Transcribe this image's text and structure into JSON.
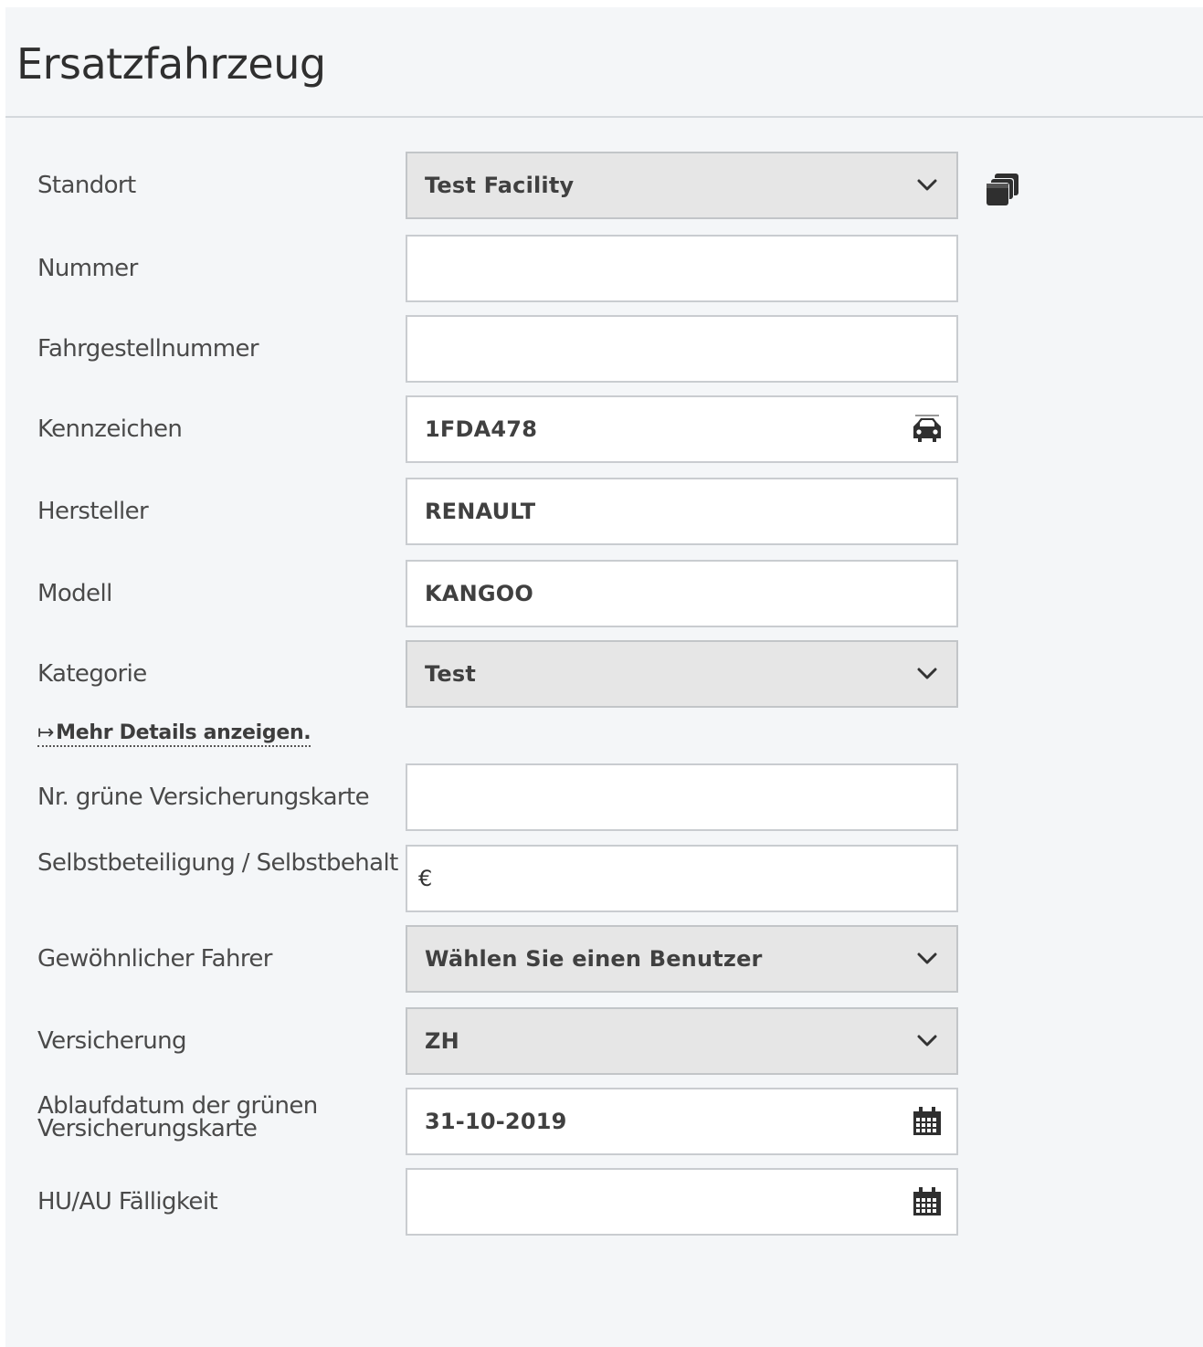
{
  "header": {
    "title": "Ersatzfahrzeug"
  },
  "form": {
    "standort": {
      "label": "Standort",
      "value": "Test Facility"
    },
    "nummer": {
      "label": "Nummer",
      "value": ""
    },
    "fahrgestellnummer": {
      "label": "Fahrgestellnummer",
      "value": ""
    },
    "kennzeichen": {
      "label": "Kennzeichen",
      "value": "1FDA478"
    },
    "hersteller": {
      "label": "Hersteller",
      "value": "RENAULT"
    },
    "modell": {
      "label": "Modell",
      "value": "KANGOO"
    },
    "kategorie": {
      "label": "Kategorie",
      "value": "Test"
    },
    "more_details": {
      "arrow": "↦",
      "label": "Mehr Details anzeigen."
    },
    "gruene_karte_nr": {
      "label": "Nr. grüne Versicherungskarte",
      "value": ""
    },
    "selbstbeteiligung": {
      "label": "Selbstbeteiligung / Selbstbehalt",
      "currency": "€",
      "value": ""
    },
    "fahrer": {
      "label": "Gewöhnlicher Fahrer",
      "value": "Wählen Sie einen Benutzer"
    },
    "versicherung": {
      "label": "Versicherung",
      "value": "ZH"
    },
    "ablaufdatum": {
      "label": "Ablaufdatum der grünen Versicherungskarte",
      "value": "31-10-2019"
    },
    "hu_au": {
      "label": "HU/AU Fälligkeit",
      "value": ""
    }
  },
  "icons": {
    "side_button": "copy-stack-icon",
    "kennzeichen_suffix": "car-icon",
    "dropdown": "chevron-down-icon",
    "date_suffix": "calendar-icon"
  },
  "colors": {
    "panel_bg": "#f4f6f8",
    "select_bg": "#e6e6e6",
    "input_border": "#c9ccd0"
  }
}
